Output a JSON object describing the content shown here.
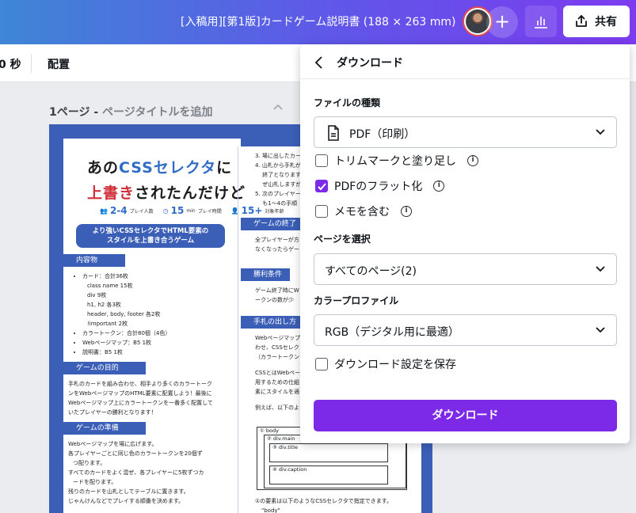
{
  "topbar": {
    "doc_title": "[入稿用][第1版]カードゲーム説明書 (188 × 263 mm)",
    "plus_label": "+",
    "share_label": "共有"
  },
  "toolbar": {
    "time_fragment": "0 秒",
    "arrange_label": "配置"
  },
  "page_header": {
    "page_label": "1ページ - ",
    "title_placeholder": "ページタイトルを追加"
  },
  "document": {
    "title_line1_pre": "あの",
    "title_line1_css": "CSSセレクタ",
    "title_line1_post": "に",
    "title_line2_red": "上書き",
    "title_line2_post": "されたんだけど",
    "stats": [
      {
        "value": "2-4",
        "caption": "プレイ人数"
      },
      {
        "value": "15",
        "unit": "min",
        "caption": "プレイ時間"
      },
      {
        "value": "15+",
        "caption": "対象年齢"
      }
    ],
    "tagline_1": "より強いCSSセレクタでHTML要素の",
    "tagline_2": "スタイルを上書き合うゲーム",
    "sections": {
      "contents": "内容物",
      "goal": "ゲームの目的",
      "setup": "ゲームの準備",
      "end": "ゲームの終了",
      "win": "勝利条件",
      "how": "手札の出し方"
    },
    "contents_items": [
      "カード：合計36枚",
      "class name 15枚",
      "div 9枚",
      "h1, h2 各3枚",
      "header, body, footer 各2枚",
      "!important 2枚",
      "カラートークン：合計80個（4色）",
      "Webページマップ：B5 1枚",
      "説明書：B5 1枚"
    ],
    "goal_text": [
      "手札のカードを組み合わせ、相手より多くのカラートーク",
      "ンをWebページマップのHTML要素に配置しよう！最後に",
      "Webページマップ上にカラートークンを一番多く配置して",
      "いたプレイヤーの勝利となります！"
    ],
    "setup_items": [
      "Webページマップを場に広げます。",
      "各プレイヤーごとに同じ色のカラートークンを20個ず",
      "つ配ります。",
      "すべてのカードをよく混ぜ、各プレイヤーに5枚ずつカ",
      "ードを配ります。",
      "残りのカードを山札としてテーブルに置きます。",
      "じゃんけんなどでプレイする順番を決めます。"
    ],
    "right_top": [
      "3. 場に出したカー",
      "4. 山札から手札が",
      "　 終了となります",
      "　 ぜ山札しますが",
      "5. 次のプレイヤー",
      "　 も1〜4の手順"
    ],
    "end_text": [
      "全プレイヤーが方",
      "なくなったらゲー"
    ],
    "win_text": [
      "ゲーム終了時にW",
      "ークンの数が少"
    ],
    "how_text": [
      "Webページマップ",
      "わせ、CSSセレク",
      "（カラートークン",
      "CSSとはWebペー",
      "用するための仕組",
      "素にスタイルを適",
      "例えば、以下のよ"
    ],
    "tree": {
      "body": "① body",
      "main": "② div.main",
      "title": "③ div.title",
      "caption": "④ div.caption"
    },
    "bottom_text": [
      "①の要素は以下のようなCSSセレクタで指定できます。",
      "\"body\""
    ]
  },
  "download_panel": {
    "title": "ダウンロード",
    "file_type_label": "ファイルの種類",
    "file_type_value": "PDF（印刷）",
    "option_trim": "トリムマークと塗り足し",
    "option_flatten": "PDFのフラット化",
    "option_notes": "メモを含む",
    "pages_label": "ページを選択",
    "pages_value": "すべてのページ(2)",
    "color_label": "カラープロファイル",
    "color_value": "RGB（デジタル用に最適）",
    "save_settings": "ダウンロード設定を保存",
    "download_button": "ダウンロード",
    "checked": {
      "trim": false,
      "flatten": true,
      "notes": false,
      "save": false
    }
  },
  "colors": {
    "accent_purple": "#7d2ae8",
    "doc_blue": "#3b5fb7",
    "title_red": "#d0303a"
  }
}
